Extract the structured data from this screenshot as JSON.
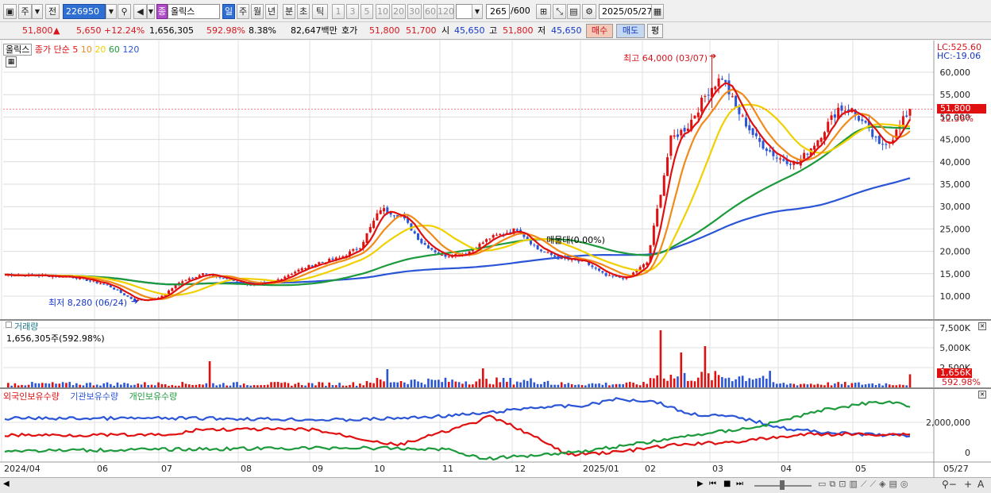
{
  "toolbar": {
    "type_label": "주",
    "prev_label": "전",
    "code": "226950",
    "stock_name_badge": "종",
    "stock_name": "올릭스",
    "periods": [
      "일",
      "주",
      "월",
      "년",
      "분",
      "초",
      "틱"
    ],
    "ticks": [
      "1",
      "3",
      "5",
      "10",
      "20",
      "30",
      "60",
      "120"
    ],
    "count": "265",
    "count_total": "/600",
    "date": "2025/05/27"
  },
  "quote": {
    "price": "51,800",
    "up_arrow": "▲",
    "change": "5,650",
    "change_pct": "+12.24%",
    "volume": "1,656,305",
    "vol_ratio": "592.98%",
    "turnover": "8.38%",
    "amount": "82,647백만",
    "hoga_label": "호가",
    "ask": "51,800",
    "bid": "51,700",
    "open_label": "시",
    "open": "45,650",
    "high_label": "고",
    "high": "51,800",
    "low_label": "저",
    "low": "45,650",
    "buy_label": "매수",
    "sell_label": "매도",
    "eval_label": "평"
  },
  "price_pane": {
    "legend_name": "올릭스",
    "legend_ma": "종가 단순",
    "ma_periods": [
      "5",
      "10",
      "20",
      "60",
      "120"
    ],
    "ma_colors": [
      "#e01010",
      "#f08a18",
      "#f0d000",
      "#1d9a3c",
      "#2a55d6"
    ],
    "lc_label": "LC:525.60",
    "hc_label": "HC:-19.06",
    "yaxis": [
      "60,000",
      "55,000",
      "50,000",
      "45,000",
      "40,000",
      "35,000",
      "30,000",
      "25,000",
      "20,000",
      "15,000",
      "10,000"
    ],
    "current_price_tag": "51,800",
    "current_pct_tag": "12.36%",
    "high_note": "최고 64,000 (03/07)",
    "low_note": "최저 8,280 (06/24)",
    "mid_note": "매물대(0.00%)"
  },
  "volume_pane": {
    "title": "거래량",
    "subtitle": "1,656,305주(592.98%)",
    "yaxis": [
      "7,500K",
      "5,000K",
      "2,500K"
    ],
    "current_tag": "1,656K",
    "current_pct": "592.98%"
  },
  "holding_pane": {
    "legend": [
      "외국인보유수량",
      "기관보유수량",
      "개인보유수량"
    ],
    "colors": [
      "#e01010",
      "#2a55d6",
      "#1d9a3c"
    ],
    "yaxis": [
      "2,000,000",
      "0"
    ]
  },
  "xaxis": [
    "2024/04",
    "06",
    "07",
    "08",
    "09",
    "10",
    "11",
    "12",
    "2025/01",
    "02",
    "03",
    "04",
    "05",
    "05/27"
  ]
}
